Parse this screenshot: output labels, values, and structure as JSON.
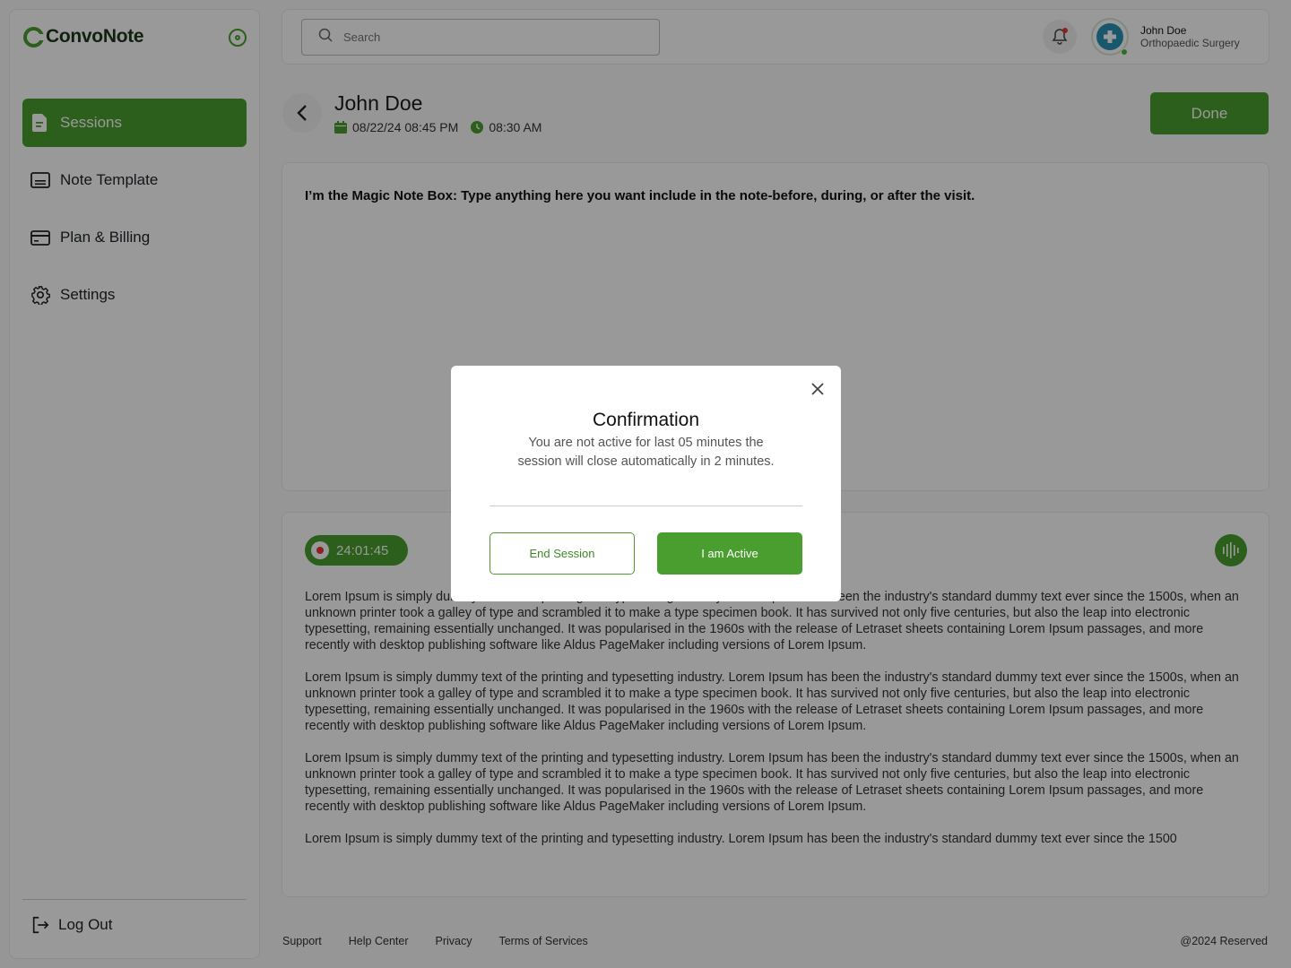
{
  "brand": {
    "name": "ConvoNote",
    "accent": "#4a9e2f"
  },
  "sidebar": {
    "items": [
      {
        "label": "Sessions",
        "icon": "document-icon",
        "active": true
      },
      {
        "label": "Note Template",
        "icon": "template-icon",
        "active": false
      },
      {
        "label": "Plan & Billing",
        "icon": "card-icon",
        "active": false
      },
      {
        "label": "Settings",
        "icon": "gear-icon",
        "active": false
      }
    ],
    "logout_label": "Log Out"
  },
  "header": {
    "search_placeholder": "Search",
    "user": {
      "name": "John Doe",
      "role": "Orthopaedic Surgery"
    },
    "notifications_unread": true
  },
  "session": {
    "title": "John Doe",
    "date": "08/22/24 08:45 PM",
    "time": "08:30 AM",
    "done_label": "Done"
  },
  "note_box": {
    "prompt": "I’m the Magic Note Box: Type anything here you want include in the note-before, during, or after the visit."
  },
  "transcript": {
    "timer": "24:01:45",
    "paragraphs": [
      "Lorem Ipsum is simply dummy text of the printing and typesetting industry. Lorem Ipsum has been the industry's standard dummy text ever since the 1500s, when an unknown printer took a galley of type and scrambled it to make a type specimen book. It has survived not only five centuries, but also the leap into electronic typesetting, remaining essentially unchanged. It was popularised in the 1960s with the release of Letraset sheets containing Lorem Ipsum passages, and more recently with desktop publishing software like Aldus PageMaker including versions of Lorem Ipsum.",
      "Lorem Ipsum is simply dummy text of the printing and typesetting industry. Lorem Ipsum has been the industry's standard dummy text ever since the 1500s, when an unknown printer took a galley of type and scrambled it to make a type specimen book. It has survived not only five centuries, but also the leap into electronic typesetting, remaining essentially unchanged. It was popularised in the 1960s with the release of Letraset sheets containing Lorem Ipsum passages, and more recently with desktop publishing software like Aldus PageMaker including versions of Lorem Ipsum.",
      "Lorem Ipsum is simply dummy text of the printing and typesetting industry. Lorem Ipsum has been the industry's standard dummy text ever since the 1500s, when an unknown printer took a galley of type and scrambled it to make a type specimen book. It has survived not only five centuries, but also the leap into electronic typesetting, remaining essentially unchanged. It was popularised in the 1960s with the release of Letraset sheets containing Lorem Ipsum passages, and more recently with desktop publishing software like Aldus PageMaker including versions of Lorem Ipsum.",
      "Lorem Ipsum is simply dummy text of the printing and typesetting industry. Lorem Ipsum has been the industry's standard dummy text ever since the 1500"
    ]
  },
  "footer": {
    "links": [
      "Support",
      "Help Center",
      "Privacy",
      "Terms of Services"
    ],
    "copyright": "@2024 Reserved"
  },
  "modal": {
    "title": "Confirmation",
    "message": "You are not active for last 05 minutes the session will close automatically in 2 minutes.",
    "end_label": "End Session",
    "active_label": "I am Active"
  }
}
